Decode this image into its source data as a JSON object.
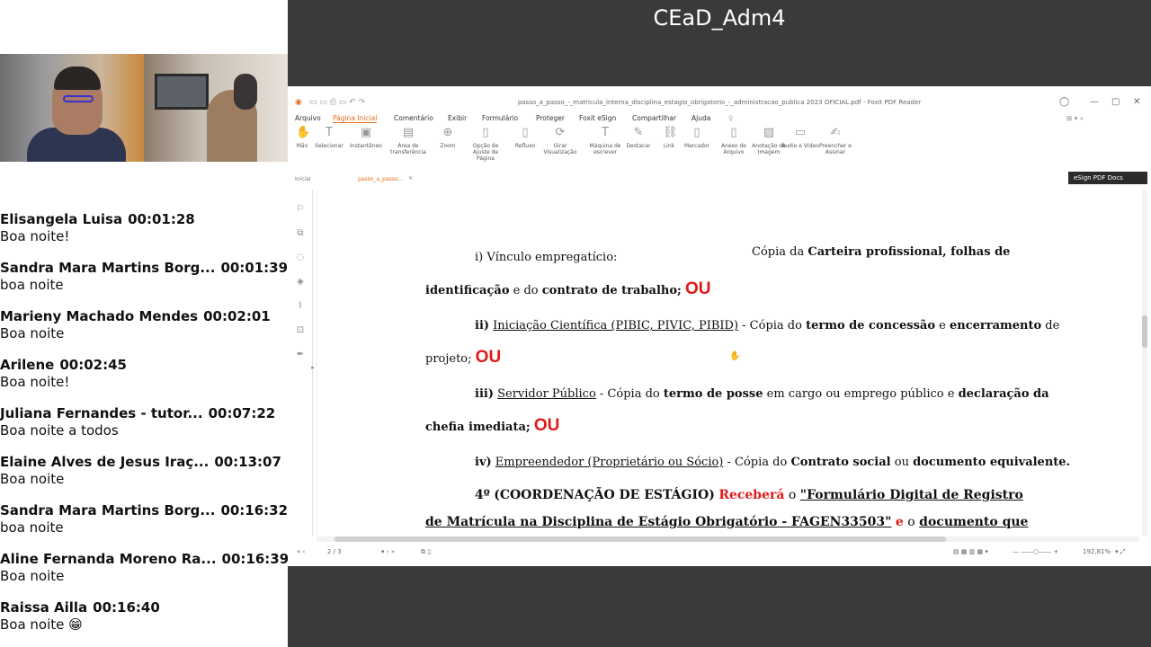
{
  "meeting": {
    "title": "CEaD_Adm4"
  },
  "chat": [
    {
      "name": "Elisangela Luisa",
      "time": "00:01:28",
      "text": "Boa noite!"
    },
    {
      "name": "Sandra Mara Martins Borg...",
      "time": "00:01:39",
      "text": "boa noite"
    },
    {
      "name": "Marieny Machado Mendes",
      "time": "00:02:01",
      "text": "Boa noite"
    },
    {
      "name": "Arilene",
      "time": "00:02:45",
      "text": "Boa noite!"
    },
    {
      "name": "Juliana Fernandes - tutor...",
      "time": "00:07:22",
      "text": "Boa noite a todos"
    },
    {
      "name": "Elaine Alves de Jesus Iraç...",
      "time": "00:13:07",
      "text": "Boa noite"
    },
    {
      "name": "Sandra Mara Martins Borg...",
      "time": "00:16:32",
      "text": "boa noite"
    },
    {
      "name": "Aline Fernanda Moreno Ra...",
      "time": "00:16:39",
      "text": "Boa noite"
    },
    {
      "name": "Raissa Ailla",
      "time": "00:16:40",
      "text": "Boa noite 😁"
    }
  ],
  "reader": {
    "window_title": "passo_a_passo_-_matricula_interna_disciplina_estagio_obrigatorio_-_administracao_publica 2023 OFICIAL.pdf - Foxit PDF Reader",
    "menu": [
      "Arquivo",
      "Página Inicial",
      "Comentário",
      "Exibir",
      "Formulário",
      "Proteger",
      "Foxit eSign",
      "Compartilhar",
      "Ajuda"
    ],
    "ribbon": [
      {
        "label": "Mão",
        "icon": "hand-icon"
      },
      {
        "label": "Selecionar",
        "icon": "select-icon"
      },
      {
        "label": "Instantâneo",
        "icon": "snapshot-icon"
      },
      {
        "label": "Área de transferência",
        "icon": "clipboard-icon"
      },
      {
        "label": "Zoom",
        "icon": "zoom-icon"
      },
      {
        "label": "Opção de Ajuste de Página",
        "icon": "fit-page-icon"
      },
      {
        "label": "Refluxo",
        "icon": "reflow-icon"
      },
      {
        "label": "Girar Visualização",
        "icon": "rotate-icon"
      },
      {
        "label": "Máquina de escrever",
        "icon": "typewriter-icon"
      },
      {
        "label": "Destacar",
        "icon": "highlight-icon"
      },
      {
        "label": "Link",
        "icon": "link-icon"
      },
      {
        "label": "Marcador",
        "icon": "bookmark-icon"
      },
      {
        "label": "Anexo de Arquivo",
        "icon": "attach-icon"
      },
      {
        "label": "Anotação de Imagem",
        "icon": "image-icon"
      },
      {
        "label": "Áudio e Vídeo",
        "icon": "media-icon"
      },
      {
        "label": "Preencher e Assinar",
        "icon": "sign-icon"
      }
    ],
    "tabs": {
      "start": "Iniciar",
      "doc": "passo_a_passo..."
    },
    "esign_label": "eSign PDF Docs",
    "page_indicator": "2 / 3",
    "zoom": "192,81%"
  },
  "document": {
    "l1a": "i) Vínculo empregatício:",
    "l1b_pre": "Cópia da ",
    "l1b_bold": "Carteira profissional, folhas de",
    "l2_bold1": "identificação",
    "l2_mid": " e do ",
    "l2_bold2": "contrato de trabalho;",
    "ou": "OU",
    "l3_num": "ii)",
    "l3_ul": "Iniciação Científica (PIBIC, PIVIC, PIBID)",
    "l3_mid": " - Cópia do ",
    "l3_bold1": "termo de concessão",
    "l3_mid2": " e ",
    "l3_bold2": "encerramento",
    "l3_end": " de",
    "l4": "projeto;",
    "l5_num": "iii)",
    "l5_ul": "Servidor Público",
    "l5_mid": " -  Cópia do ",
    "l5_bold1": "termo de posse",
    "l5_mid2": " em cargo ou emprego público e ",
    "l5_bold2": "declaração da",
    "l6_bold": "chefia imediata;",
    "l7_num": "iv)",
    "l7_ul": "Empreendedor (Proprietário ou Sócio)",
    "l7_mid": " - Cópia do ",
    "l7_bold1": "Contrato social",
    "l7_mid2": " ou ",
    "l7_bold2": "documento equivalente.",
    "l8_num": "4º",
    "l8_bold": "(COORDENAÇÃO DE ESTÁGIO)",
    "l8_red": "Receberá",
    "l8_o": " o ",
    "l8_ul": "\"Formulário Digital de Registro",
    "l9_ul": "de Matrícula na Disciplina de Estágio Obrigatório - FAGEN33503\"",
    "l9_red": "e",
    "l9_o": " o ",
    "l9_ul2": "documento que"
  }
}
